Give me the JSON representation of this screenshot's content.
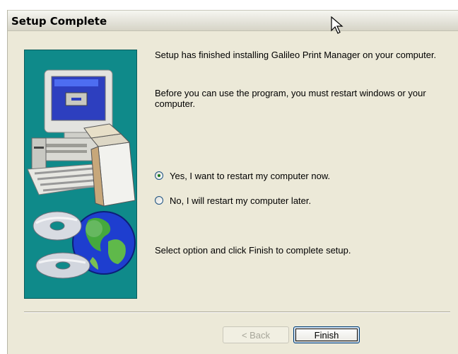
{
  "window": {
    "title": "Setup Complete"
  },
  "content": {
    "message1": "Setup has finished installing Galileo Print Manager on your computer.",
    "message2": "Before you can use the program, you must restart windows or your computer.",
    "options": [
      {
        "label": "Yes, I want to restart my computer now.",
        "checked": true
      },
      {
        "label": "No, I will restart my computer later.",
        "checked": false
      }
    ],
    "instruction": "Select option and click Finish to complete setup."
  },
  "buttons": {
    "back": "< Back",
    "finish": "Finish"
  },
  "colors": {
    "panel": "#0f8a8a",
    "dialog_bg": "#ece9d8"
  },
  "icons": [
    "computer-illustration",
    "globe-icon",
    "cd-icon",
    "mouse-cursor"
  ]
}
